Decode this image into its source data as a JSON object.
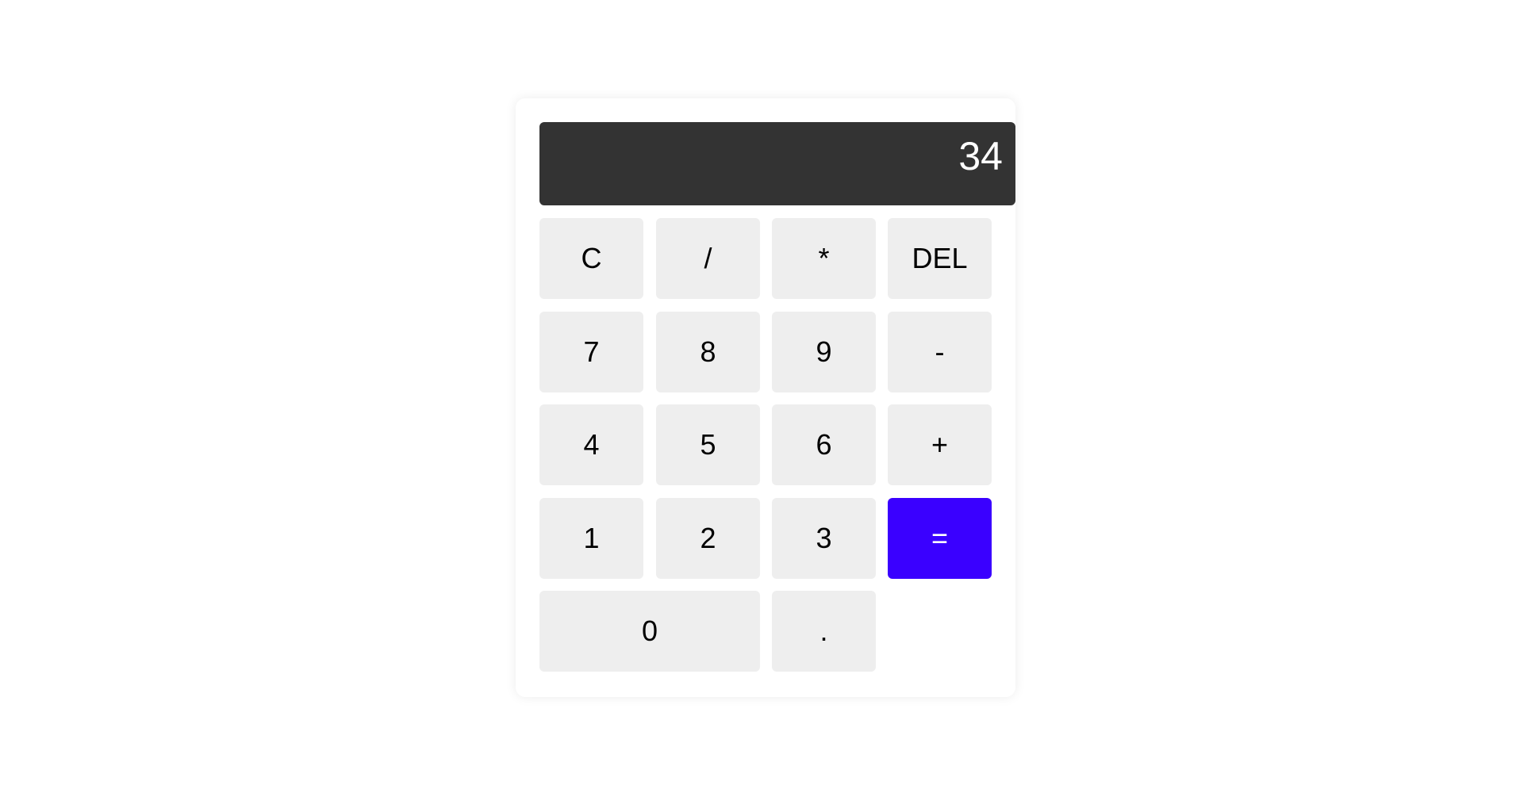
{
  "display": {
    "value": "34"
  },
  "keys": {
    "clear": "C",
    "divide": "/",
    "multiply": "*",
    "delete": "DEL",
    "seven": "7",
    "eight": "8",
    "nine": "9",
    "minus": "-",
    "four": "4",
    "five": "5",
    "six": "6",
    "plus": "+",
    "one": "1",
    "two": "2",
    "three": "3",
    "equals": "=",
    "zero": "0",
    "decimal": "."
  },
  "colors": {
    "display_bg": "#333333",
    "key_bg": "#eeeeee",
    "accent": "#3a00ff"
  }
}
